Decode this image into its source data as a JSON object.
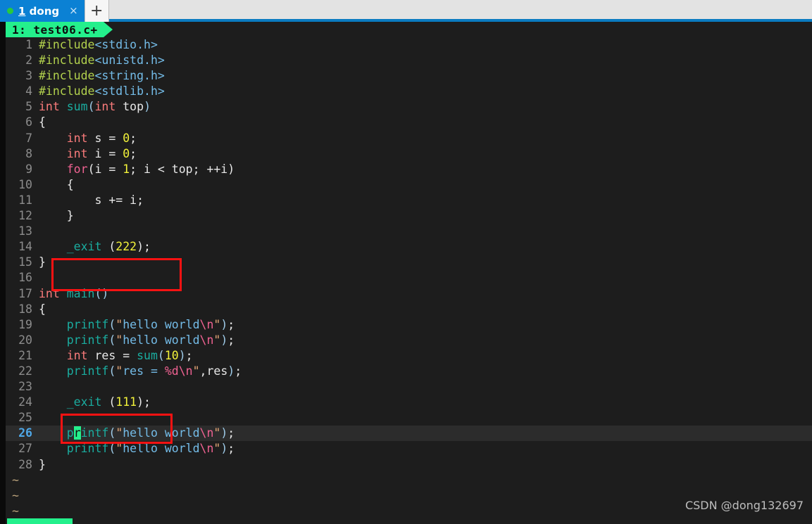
{
  "window": {
    "tabbar": {
      "tabs": [
        {
          "status_dot": "running-dot",
          "accel": "1",
          "title": " dong",
          "close_label": "×"
        }
      ],
      "new_tab_label": "+"
    }
  },
  "vim": {
    "tabline": {
      "label": "1: test06.c+"
    },
    "status_segment": "",
    "filler_char": "~",
    "filler_count": 3,
    "cursor": {
      "line": 26,
      "column": 7,
      "char": "r"
    },
    "lines": [
      {
        "n": "1",
        "current": false,
        "tokens": [
          {
            "t": "#include",
            "c": "c-pre"
          },
          {
            "t": "<stdio.h>",
            "c": "c-hdr"
          }
        ]
      },
      {
        "n": "2",
        "current": false,
        "tokens": [
          {
            "t": "#include",
            "c": "c-pre"
          },
          {
            "t": "<unistd.h>",
            "c": "c-hdr"
          }
        ]
      },
      {
        "n": "3",
        "current": false,
        "tokens": [
          {
            "t": "#include",
            "c": "c-pre"
          },
          {
            "t": "<string.h>",
            "c": "c-hdr"
          }
        ]
      },
      {
        "n": "4",
        "current": false,
        "tokens": [
          {
            "t": "#include",
            "c": "c-pre"
          },
          {
            "t": "<stdlib.h>",
            "c": "c-hdr"
          }
        ]
      },
      {
        "n": "5",
        "current": false,
        "tokens": [
          {
            "t": "int",
            "c": "c-type"
          },
          {
            "t": " ",
            "c": "c-plain"
          },
          {
            "t": "sum",
            "c": "c-fn"
          },
          {
            "t": "(",
            "c": "c-punct"
          },
          {
            "t": "int",
            "c": "c-type"
          },
          {
            "t": " top",
            "c": "c-plain"
          },
          {
            "t": ")",
            "c": "c-punct"
          }
        ]
      },
      {
        "n": "6",
        "current": false,
        "tokens": [
          {
            "t": "{",
            "c": "c-brace"
          }
        ]
      },
      {
        "n": "7",
        "current": false,
        "tokens": [
          {
            "t": "    ",
            "c": "c-plain"
          },
          {
            "t": "int",
            "c": "c-type"
          },
          {
            "t": " s = ",
            "c": "c-plain"
          },
          {
            "t": "0",
            "c": "c-num"
          },
          {
            "t": ";",
            "c": "c-plain"
          }
        ]
      },
      {
        "n": "8",
        "current": false,
        "tokens": [
          {
            "t": "    ",
            "c": "c-plain"
          },
          {
            "t": "int",
            "c": "c-type"
          },
          {
            "t": " i = ",
            "c": "c-plain"
          },
          {
            "t": "0",
            "c": "c-num"
          },
          {
            "t": ";",
            "c": "c-plain"
          }
        ]
      },
      {
        "n": "9",
        "current": false,
        "tokens": [
          {
            "t": "    ",
            "c": "c-plain"
          },
          {
            "t": "for",
            "c": "c-kw"
          },
          {
            "t": "(i = ",
            "c": "c-plain"
          },
          {
            "t": "1",
            "c": "c-num"
          },
          {
            "t": "; i < top; ++i)",
            "c": "c-plain"
          }
        ]
      },
      {
        "n": "10",
        "current": false,
        "tokens": [
          {
            "t": "    {",
            "c": "c-brace"
          }
        ]
      },
      {
        "n": "11",
        "current": false,
        "tokens": [
          {
            "t": "        s += i;",
            "c": "c-plain"
          }
        ]
      },
      {
        "n": "12",
        "current": false,
        "tokens": [
          {
            "t": "    }",
            "c": "c-brace"
          }
        ]
      },
      {
        "n": "13",
        "current": false,
        "tokens": []
      },
      {
        "n": "14",
        "current": false,
        "tokens": [
          {
            "t": "    ",
            "c": "c-plain"
          },
          {
            "t": "_exit",
            "c": "c-fn"
          },
          {
            "t": " (",
            "c": "c-plain"
          },
          {
            "t": "222",
            "c": "c-num"
          },
          {
            "t": ");",
            "c": "c-plain"
          }
        ]
      },
      {
        "n": "15",
        "current": false,
        "tokens": [
          {
            "t": "}",
            "c": "c-brace"
          }
        ]
      },
      {
        "n": "16",
        "current": false,
        "tokens": []
      },
      {
        "n": "17",
        "current": false,
        "tokens": [
          {
            "t": "int",
            "c": "c-type"
          },
          {
            "t": " ",
            "c": "c-plain"
          },
          {
            "t": "main",
            "c": "c-fn"
          },
          {
            "t": "()",
            "c": "c-punct"
          }
        ]
      },
      {
        "n": "18",
        "current": false,
        "tokens": [
          {
            "t": "{",
            "c": "c-brace"
          }
        ]
      },
      {
        "n": "19",
        "current": false,
        "tokens": [
          {
            "t": "    ",
            "c": "c-plain"
          },
          {
            "t": "printf",
            "c": "c-fn"
          },
          {
            "t": "(",
            "c": "c-punct"
          },
          {
            "t": "\"",
            "c": "c-quote"
          },
          {
            "t": "hello world",
            "c": "c-str"
          },
          {
            "t": "\\n",
            "c": "c-esc"
          },
          {
            "t": "\"",
            "c": "c-quote"
          },
          {
            "t": ")",
            "c": "c-punct"
          },
          {
            "t": ";",
            "c": "c-plain"
          }
        ]
      },
      {
        "n": "20",
        "current": false,
        "tokens": [
          {
            "t": "    ",
            "c": "c-plain"
          },
          {
            "t": "printf",
            "c": "c-fn"
          },
          {
            "t": "(",
            "c": "c-punct"
          },
          {
            "t": "\"",
            "c": "c-quote"
          },
          {
            "t": "hello world",
            "c": "c-str"
          },
          {
            "t": "\\n",
            "c": "c-esc"
          },
          {
            "t": "\"",
            "c": "c-quote"
          },
          {
            "t": ")",
            "c": "c-punct"
          },
          {
            "t": ";",
            "c": "c-plain"
          }
        ]
      },
      {
        "n": "21",
        "current": false,
        "tokens": [
          {
            "t": "    ",
            "c": "c-plain"
          },
          {
            "t": "int",
            "c": "c-type"
          },
          {
            "t": " res = ",
            "c": "c-plain"
          },
          {
            "t": "sum",
            "c": "c-fn"
          },
          {
            "t": "(",
            "c": "c-punct"
          },
          {
            "t": "10",
            "c": "c-num"
          },
          {
            "t": ")",
            "c": "c-punct"
          },
          {
            "t": ";",
            "c": "c-plain"
          }
        ]
      },
      {
        "n": "22",
        "current": false,
        "tokens": [
          {
            "t": "    ",
            "c": "c-plain"
          },
          {
            "t": "printf",
            "c": "c-fn"
          },
          {
            "t": "(",
            "c": "c-punct"
          },
          {
            "t": "\"",
            "c": "c-quote"
          },
          {
            "t": "res = ",
            "c": "c-str"
          },
          {
            "t": "%d",
            "c": "c-esc"
          },
          {
            "t": "\\n",
            "c": "c-esc"
          },
          {
            "t": "\"",
            "c": "c-quote"
          },
          {
            "t": ",res",
            "c": "c-plain"
          },
          {
            "t": ")",
            "c": "c-punct"
          },
          {
            "t": ";",
            "c": "c-plain"
          }
        ]
      },
      {
        "n": "23",
        "current": false,
        "tokens": []
      },
      {
        "n": "24",
        "current": false,
        "tokens": [
          {
            "t": "    ",
            "c": "c-plain"
          },
          {
            "t": "_exit",
            "c": "c-fn"
          },
          {
            "t": " (",
            "c": "c-plain"
          },
          {
            "t": "111",
            "c": "c-num"
          },
          {
            "t": ");",
            "c": "c-plain"
          }
        ]
      },
      {
        "n": "25",
        "current": false,
        "tokens": []
      },
      {
        "n": "26",
        "current": true,
        "tokens": [
          {
            "t": "    ",
            "c": "c-plain"
          },
          {
            "t": "p",
            "c": "c-fn"
          },
          {
            "t": "r",
            "c": "cursor"
          },
          {
            "t": "intf",
            "c": "c-fn"
          },
          {
            "t": "(",
            "c": "c-punct"
          },
          {
            "t": "\"",
            "c": "c-quote"
          },
          {
            "t": "hello world",
            "c": "c-str"
          },
          {
            "t": "\\n",
            "c": "c-esc"
          },
          {
            "t": "\"",
            "c": "c-quote"
          },
          {
            "t": ")",
            "c": "c-punct"
          },
          {
            "t": ";",
            "c": "c-plain"
          }
        ]
      },
      {
        "n": "27",
        "current": false,
        "tokens": [
          {
            "t": "    ",
            "c": "c-plain"
          },
          {
            "t": "printf",
            "c": "c-fn"
          },
          {
            "t": "(",
            "c": "c-punct"
          },
          {
            "t": "\"",
            "c": "c-quote"
          },
          {
            "t": "hello world",
            "c": "c-str"
          },
          {
            "t": "\\n",
            "c": "c-esc"
          },
          {
            "t": "\"",
            "c": "c-quote"
          },
          {
            "t": ")",
            "c": "c-punct"
          },
          {
            "t": ";",
            "c": "c-plain"
          }
        ]
      },
      {
        "n": "28",
        "current": false,
        "tokens": [
          {
            "t": "}",
            "c": "c-brace"
          }
        ]
      }
    ]
  },
  "annotations": {
    "boxes": [
      {
        "id": "redbox-1",
        "color": "#fb1212",
        "targets_line": "14"
      },
      {
        "id": "redbox-2",
        "color": "#fb1212",
        "targets_line": "24"
      }
    ]
  },
  "watermark": {
    "text": "CSDN @dong132697"
  },
  "colors": {
    "tab_active_bg": "#0b81d4",
    "tabbar_bg": "#e3e3e3",
    "terminal_bg": "#1d1d1d",
    "vim_tab_bg": "#24f08c",
    "cursor_bg": "#24f08c",
    "annotation_red": "#fb1212",
    "cursor_line_nr": "#4fa8e8"
  }
}
